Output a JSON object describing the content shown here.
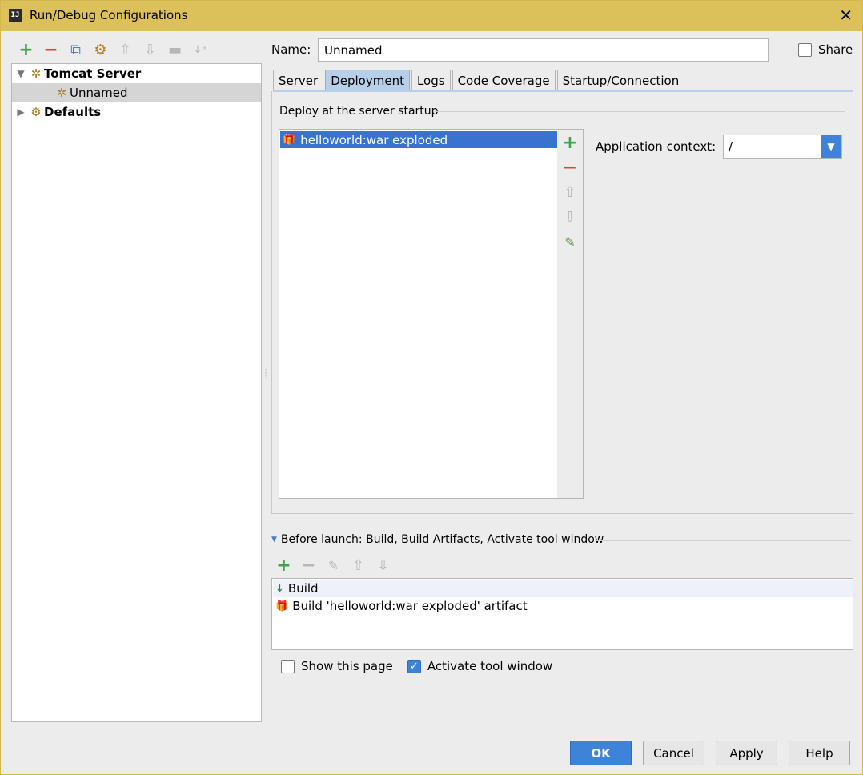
{
  "window": {
    "title": "Run/Debug Configurations",
    "app_icon_text": "IJ",
    "close_glyph": "✕"
  },
  "left_toolbar": {
    "icons": [
      "add-icon",
      "remove-icon",
      "copy-icon",
      "edit-defaults-icon",
      "move-up-icon",
      "move-down-icon",
      "folder-icon",
      "sort-icon"
    ]
  },
  "tree": {
    "items": [
      {
        "label": "Tomcat Server",
        "icon": "tomcat-icon",
        "expanded": true,
        "bold": true
      },
      {
        "label": "Unnamed",
        "icon": "tomcat-icon",
        "selected": true
      },
      {
        "label": "Defaults",
        "icon": "defaults-icon",
        "expanded": false,
        "bold": true
      }
    ]
  },
  "name_field": {
    "label": "Name:",
    "value": "Unnamed"
  },
  "share": {
    "label": "Share",
    "checked": false
  },
  "tabs": [
    {
      "label": "Server",
      "active": false
    },
    {
      "label": "Deployment",
      "active": true
    },
    {
      "label": "Logs",
      "active": false
    },
    {
      "label": "Code Coverage",
      "active": false
    },
    {
      "label": "Startup/Connection",
      "active": false
    }
  ],
  "deployment": {
    "section_title": "Deploy at the server startup",
    "items": [
      {
        "label": "helloworld:war exploded",
        "icon": "artifact-icon",
        "selected": true
      }
    ],
    "tools": [
      "add-icon",
      "remove-icon",
      "move-up-icon",
      "move-down-icon",
      "edit-icon"
    ],
    "app_context_label": "Application context:",
    "app_context_value": "/"
  },
  "before_launch": {
    "title": "Before launch: Build, Build Artifacts, Activate tool window",
    "tools": [
      "add-icon",
      "remove-icon",
      "edit-icon",
      "move-up-icon",
      "move-down-icon"
    ],
    "items": [
      {
        "label": "Build",
        "icon": "build-icon"
      },
      {
        "label": "Build 'helloworld:war exploded' artifact",
        "icon": "artifact-icon"
      }
    ]
  },
  "options": {
    "show_this_page": {
      "label": "Show this page",
      "checked": false
    },
    "activate_tool_window": {
      "label": "Activate tool window",
      "checked": true
    }
  },
  "buttons": {
    "ok": "OK",
    "cancel": "Cancel",
    "apply": "Apply",
    "help": "Help"
  },
  "colors": {
    "titlebar": "#dcc05a",
    "accent": "#3e83d8",
    "selection": "#3873d0",
    "add_green": "#3fa34d",
    "remove_red": "#d6463b"
  }
}
